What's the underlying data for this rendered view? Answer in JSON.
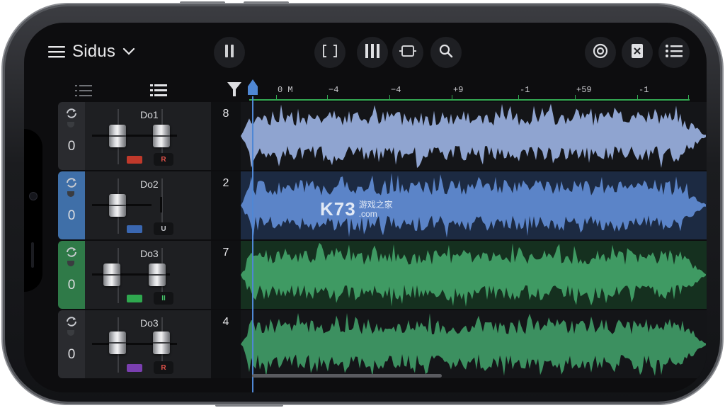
{
  "header": {
    "menu_icon": "hamburger-icon",
    "song_title": "Sidus",
    "dropdown_icon": "chevron-down-icon",
    "controls": [
      {
        "name": "pause",
        "icon": "pause-icon"
      },
      {
        "name": "loop-region",
        "icon": "loop-bracket-icon"
      },
      {
        "name": "mixer-view",
        "icon": "mixer-bars-icon"
      },
      {
        "name": "edit-mode",
        "icon": "mode-icon"
      },
      {
        "name": "search",
        "icon": "search-icon"
      },
      {
        "name": "settings",
        "icon": "gear-icon"
      },
      {
        "name": "document",
        "icon": "document-icon"
      },
      {
        "name": "list",
        "icon": "list-icon"
      }
    ]
  },
  "ruler": {
    "labels": [
      "0 M",
      "−4",
      "−4",
      "+9",
      "‑1",
      "+59",
      "‑1"
    ]
  },
  "tracks": [
    {
      "name": "Do1",
      "number": "8",
      "value": "0",
      "color": "#8fa4d0",
      "head_color": "#2a2b2f",
      "swatch": "#c0392b",
      "badge": "R",
      "badge_color": "#e0524a"
    },
    {
      "name": "Do2",
      "number": "2",
      "value": "0",
      "color": "#5b84c8",
      "head_color": "#3f6fa8",
      "swatch": "#3a67b1",
      "badge": "U",
      "badge_color": "#c9cbd0"
    },
    {
      "name": "Do3",
      "number": "7",
      "value": "0",
      "color": "#3f9a63",
      "head_color": "#2f7a48",
      "swatch": "#2fa84f",
      "badge": "II",
      "badge_color": "#46c46a"
    },
    {
      "name": "Do3",
      "number": "4",
      "value": "0",
      "color": "#3c9060",
      "head_color": "#2a2b2f",
      "swatch": "#7a3fb0",
      "badge": "R",
      "badge_color": "#e0524a"
    }
  ],
  "watermark": {
    "main": "K73",
    "cn": "游戏之家",
    "domain": ".com"
  },
  "colors": {
    "accent_green": "#33a852",
    "playhead_blue": "#4f87d4"
  }
}
